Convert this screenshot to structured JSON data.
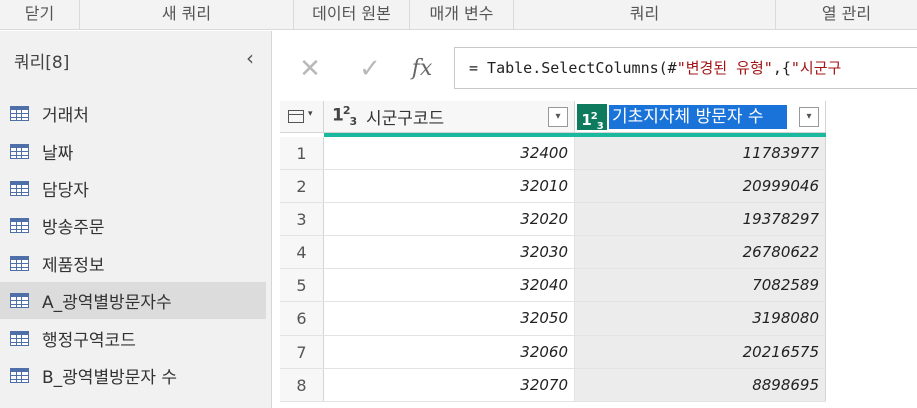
{
  "ribbon": {
    "groups": [
      {
        "label": "닫기"
      },
      {
        "label": "새 쿼리"
      },
      {
        "label": "데이터 원본"
      },
      {
        "label": "매개 변수"
      },
      {
        "label": "쿼리"
      },
      {
        "label": "열 관리"
      }
    ]
  },
  "pane": {
    "title": "쿼리[8]",
    "collapse_glyph": "‹",
    "queries": [
      {
        "label": "거래처",
        "selected": false
      },
      {
        "label": "날짜",
        "selected": false
      },
      {
        "label": "담당자",
        "selected": false
      },
      {
        "label": "방송주문",
        "selected": false
      },
      {
        "label": "제품정보",
        "selected": false
      },
      {
        "label": "A_광역별방문자수",
        "selected": true
      },
      {
        "label": "행정구역코드",
        "selected": false
      },
      {
        "label": "B_광역별방문자 수",
        "selected": false
      }
    ]
  },
  "formula_bar": {
    "cancel_glyph": "✕",
    "confirm_glyph": "✓",
    "fx_glyph": "fx",
    "formula_prefix": "= Table.SelectColumns(#",
    "formula_str": "\"변경된 유형\"",
    "formula_mid": ",{",
    "formula_str2": "\"시군구"
  },
  "grid": {
    "columns": [
      {
        "type_icon": "123",
        "name": "시군구코드"
      },
      {
        "type_icon": "123",
        "name": "기초지자체 방문자 수"
      }
    ],
    "rows": [
      {
        "n": "1",
        "a": "32400",
        "b": "11783977"
      },
      {
        "n": "2",
        "a": "32010",
        "b": "20999046"
      },
      {
        "n": "3",
        "a": "32020",
        "b": "19378297"
      },
      {
        "n": "4",
        "a": "32030",
        "b": "26780622"
      },
      {
        "n": "5",
        "a": "32040",
        "b": "7082589"
      },
      {
        "n": "6",
        "a": "32050",
        "b": "3198080"
      },
      {
        "n": "7",
        "a": "32060",
        "b": "20216575"
      },
      {
        "n": "8",
        "a": "32070",
        "b": "8898695"
      }
    ]
  },
  "colors": {
    "accent_teal": "#1bb8a0",
    "selected_header": "#1a73d9",
    "type_icon_bg": "#0e7a5e"
  }
}
